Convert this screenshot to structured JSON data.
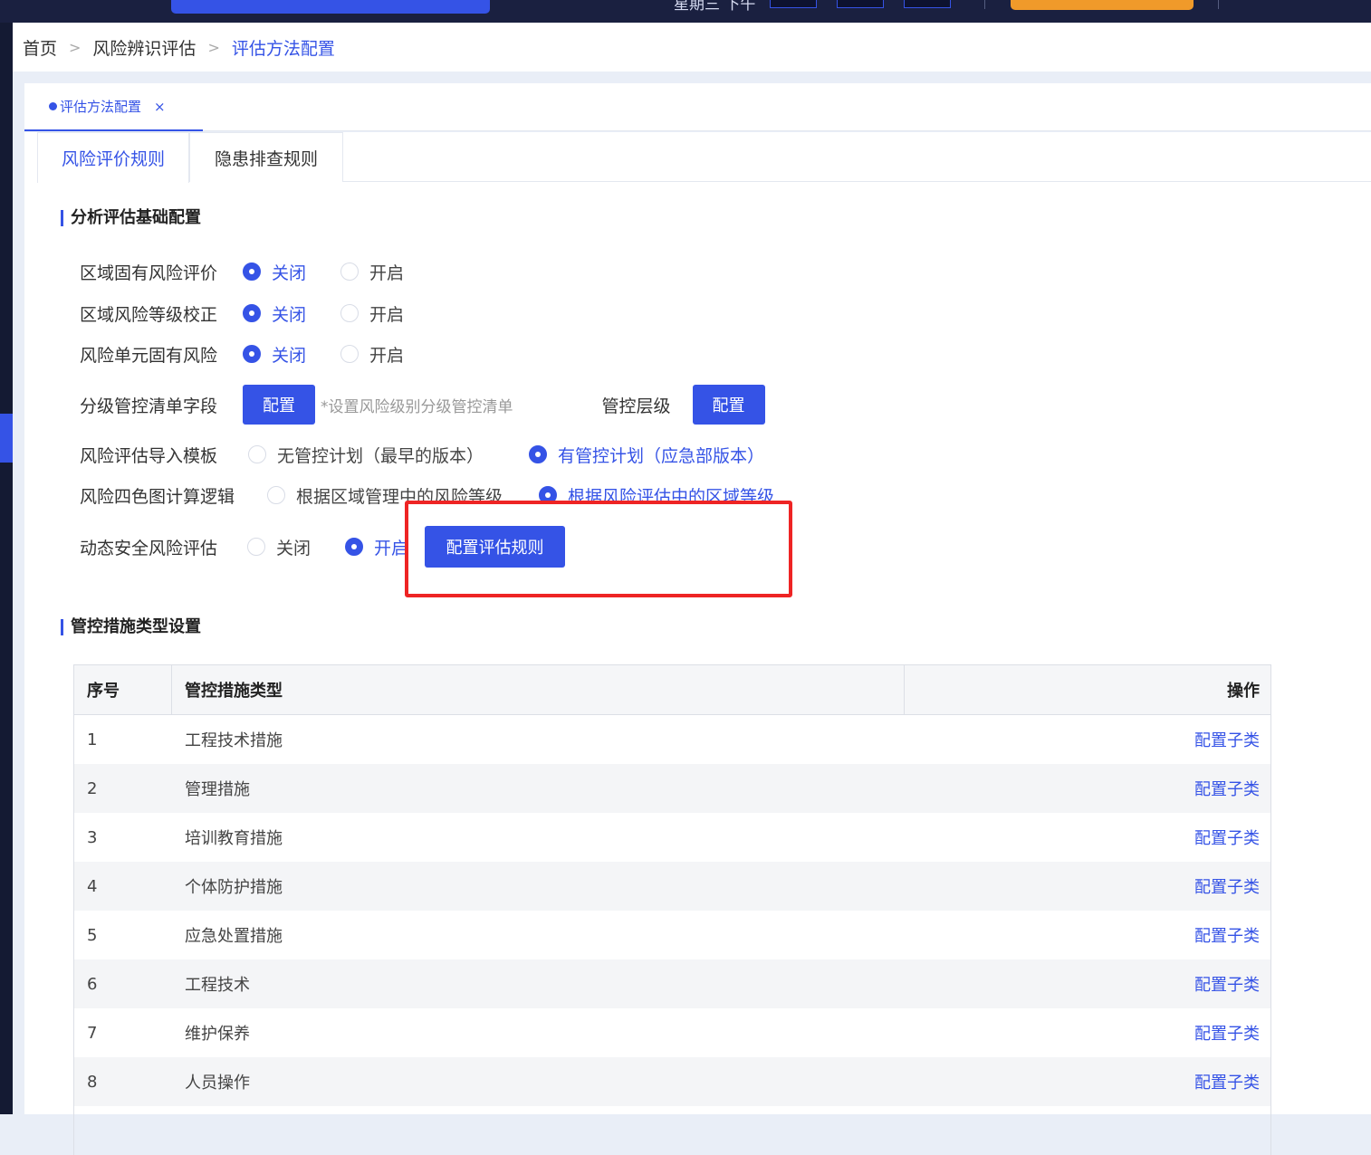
{
  "topbar": {
    "date_text": "星期三 下午"
  },
  "breadcrumb": {
    "items": [
      "首页",
      "风险辨识评估",
      "评估方法配置"
    ],
    "separator": ">"
  },
  "page_tab": {
    "label": "评估方法配置",
    "close": "×"
  },
  "sub_tabs": [
    {
      "label": "风险评价规则",
      "active": true
    },
    {
      "label": "隐患排查规则",
      "active": false
    }
  ],
  "basic_config": {
    "title": "分析评估基础配置",
    "rows": [
      {
        "label": "区域固有风险评价",
        "options": [
          "关闭",
          "开启"
        ],
        "selected": "关闭"
      },
      {
        "label": "区域风险等级校正",
        "options": [
          "关闭",
          "开启"
        ],
        "selected": "关闭"
      },
      {
        "label": "风险单元固有风险",
        "options": [
          "关闭",
          "开启"
        ],
        "selected": "关闭"
      }
    ],
    "control_list": {
      "label": "分级管控清单字段",
      "button": "配置",
      "hint": "*设置风险级别分级管控清单",
      "level_label": "管控层级",
      "level_button": "配置"
    },
    "import_template": {
      "label": "风险评估导入模板",
      "options": [
        "无管控计划（最早的版本）",
        "有管控计划（应急部版本）"
      ],
      "selected": "有管控计划（应急部版本）"
    },
    "four_color": {
      "label": "风险四色图计算逻辑",
      "options": [
        "根据区域管理中的风险等级",
        "根据风险评估中的区域等级"
      ],
      "selected": "根据风险评估中的区域等级"
    },
    "dynamic": {
      "label": "动态安全风险评估",
      "options": [
        "关闭",
        "开启"
      ],
      "selected": "开启",
      "button": "配置评估规则"
    }
  },
  "measures": {
    "title": "管控措施类型设置",
    "columns": [
      "序号",
      "管控措施类型",
      "操作"
    ],
    "action_label": "配置子类",
    "rows": [
      {
        "no": "1",
        "type": "工程技术措施"
      },
      {
        "no": "2",
        "type": "管理措施"
      },
      {
        "no": "3",
        "type": "培训教育措施"
      },
      {
        "no": "4",
        "type": "个体防护措施"
      },
      {
        "no": "5",
        "type": "应急处置措施"
      },
      {
        "no": "6",
        "type": "工程技术"
      },
      {
        "no": "7",
        "type": "维护保养"
      },
      {
        "no": "8",
        "type": "人员操作"
      }
    ]
  },
  "colors": {
    "primary": "#3553e6",
    "highlight_border": "#ee2424",
    "orange": "#f09a2a",
    "dark_header": "#1a2040"
  }
}
